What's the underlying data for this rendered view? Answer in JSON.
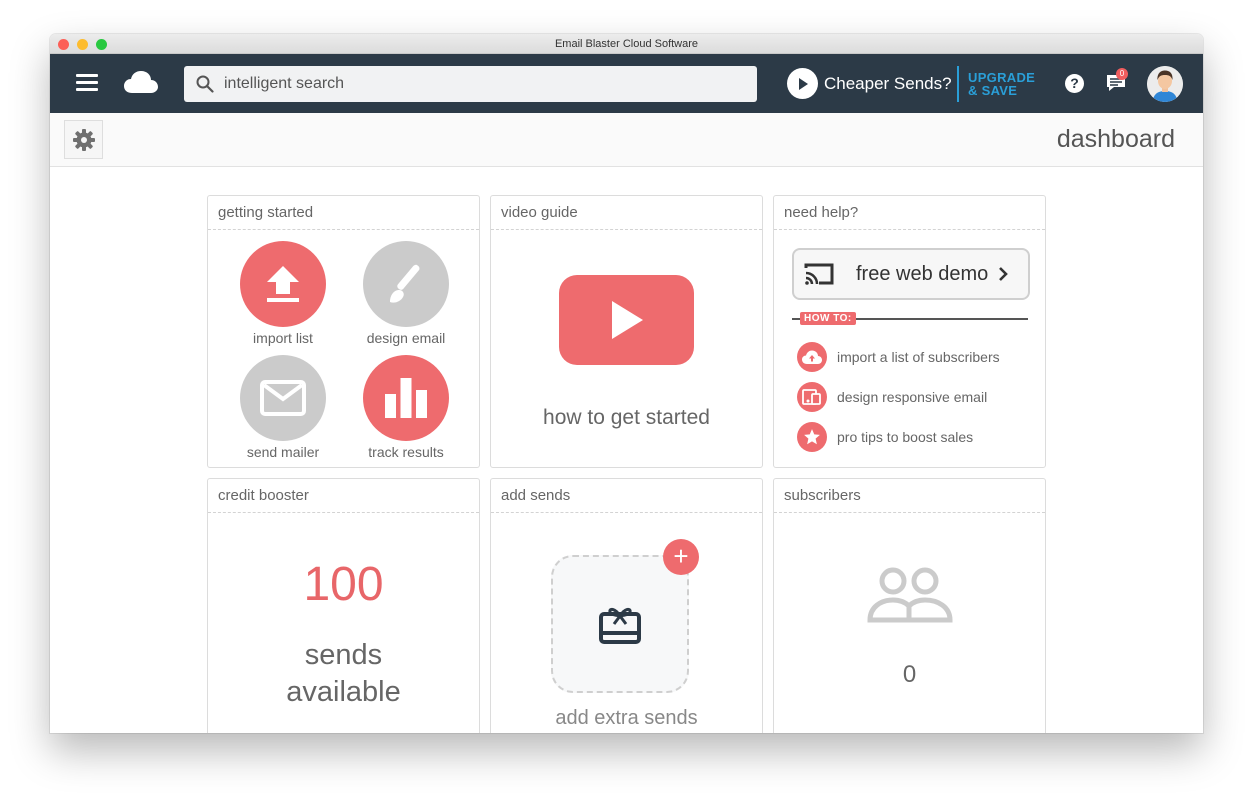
{
  "window": {
    "title": "Email Blaster Cloud Software"
  },
  "topnav": {
    "search": {
      "value": "",
      "placeholder": "intelligent search"
    },
    "promo_label": "Cheaper Sends?",
    "upgrade_line1": "UPGRADE",
    "upgrade_line2": "& SAVE",
    "help_label": "?",
    "message_badge": "0",
    "colors": {
      "nav_bg": "#2c3a47",
      "accent_blue": "#2a9fd8",
      "accent_red": "#ee6b6e"
    }
  },
  "subbar": {
    "page_title": "dashboard"
  },
  "cards": {
    "getting_started": {
      "title": "getting started",
      "items": [
        {
          "label": "import list",
          "icon": "upload-icon"
        },
        {
          "label": "design email",
          "icon": "brush-icon"
        },
        {
          "label": "send mailer",
          "icon": "envelope-icon"
        },
        {
          "label": "track results",
          "icon": "bar-chart-icon"
        }
      ]
    },
    "video_guide": {
      "title": "video guide",
      "caption": "how to get started"
    },
    "need_help": {
      "title": "need help?",
      "demo_label": "free web demo",
      "howto_tag": "HOW TO:",
      "items": [
        {
          "label": "import a list of subscribers",
          "icon": "cloud-upload-icon"
        },
        {
          "label": "design responsive email",
          "icon": "devices-icon"
        },
        {
          "label": "pro tips to boost sales",
          "icon": "star-icon"
        }
      ]
    },
    "credit_booster": {
      "title": "credit booster",
      "count": "100",
      "label_line1": "sends",
      "label_line2": "available"
    },
    "add_sends": {
      "title": "add sends",
      "plus": "+",
      "caption": "add extra sends"
    },
    "subscribers": {
      "title": "subscribers",
      "count": "0"
    }
  }
}
